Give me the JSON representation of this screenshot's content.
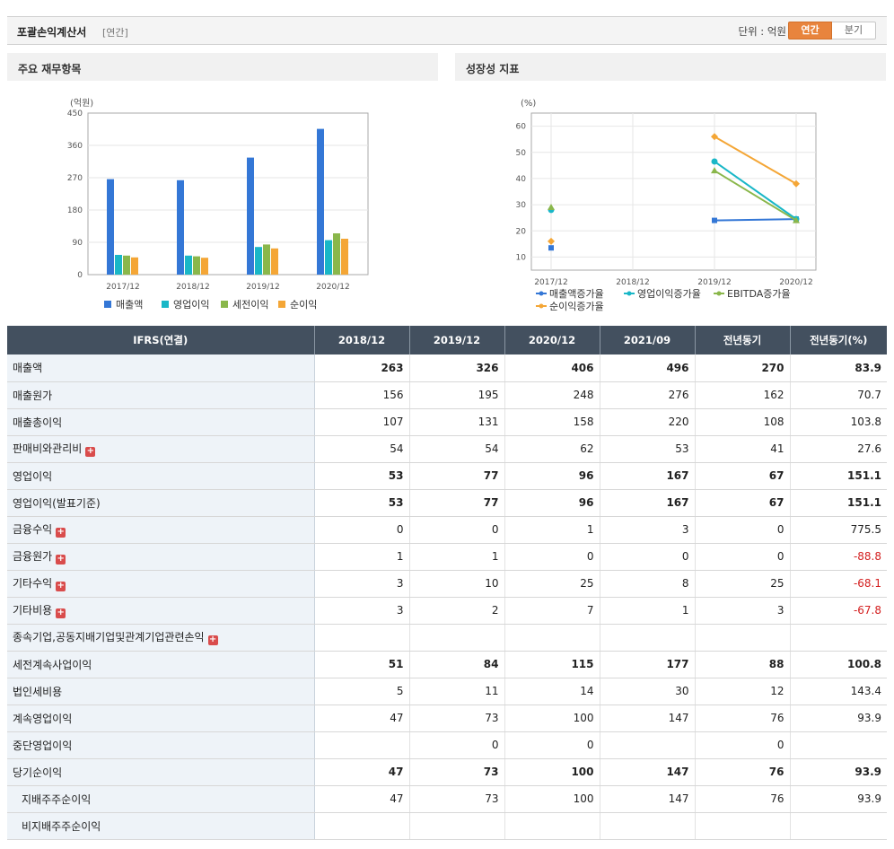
{
  "header": {
    "title": "포괄손익계산서",
    "period": "[연간]",
    "unit": "단위 : 억원",
    "tabs": [
      {
        "label": "연간",
        "active": true
      },
      {
        "label": "분기",
        "active": false
      }
    ]
  },
  "colors": {
    "revenue": "#3477d6",
    "op_income": "#19b7c7",
    "pretax": "#8ab74b",
    "net": "#f4a636",
    "header_bg": "#43505f",
    "negative": "#d42020",
    "tab_active": "#e8843d"
  },
  "chart_data": [
    {
      "type": "bar",
      "title": "주요 재무항목",
      "ylabel": "(억원)",
      "categories": [
        "2017/12",
        "2018/12",
        "2019/12",
        "2020/12"
      ],
      "ylim": [
        0,
        450
      ],
      "yticks": [
        "0",
        "90",
        "180",
        "270",
        "360",
        "450"
      ],
      "series": [
        {
          "name": "매출액",
          "values": [
            266,
            263,
            326,
            406
          ]
        },
        {
          "name": "영업이익",
          "values": [
            55,
            53,
            77,
            96
          ]
        },
        {
          "name": "세전이익",
          "values": [
            53,
            51,
            84,
            115
          ]
        },
        {
          "name": "순이익",
          "values": [
            48,
            47,
            73,
            100
          ]
        }
      ],
      "legend": "bottom",
      "grid": true
    },
    {
      "type": "line",
      "title": "성장성 지표",
      "ylabel": "(%)",
      "categories": [
        "2017/12",
        "2018/12",
        "2019/12",
        "2020/12"
      ],
      "ylim": [
        5,
        65
      ],
      "yticks": [
        "10",
        "20",
        "30",
        "40",
        "50",
        "60"
      ],
      "series": [
        {
          "name": "매출액증가율",
          "values": [
            13.5,
            null,
            24,
            24.5
          ]
        },
        {
          "name": "영업이익증가율",
          "values": [
            28,
            null,
            46.5,
            24.5
          ]
        },
        {
          "name": "EBITDA증가율",
          "values": [
            29,
            null,
            43,
            24
          ]
        },
        {
          "name": "순이익증가율",
          "values": [
            16,
            null,
            56,
            38
          ]
        }
      ],
      "legend": "bottom",
      "grid": true
    }
  ],
  "table": {
    "columns": [
      "IFRS(연결)",
      "2018/12",
      "2019/12",
      "2020/12",
      "2021/09",
      "전년동기",
      "전년동기(%)"
    ],
    "rows": [
      {
        "label": "매출액",
        "bold": true,
        "values": [
          "263",
          "326",
          "406",
          "496",
          "270",
          "83.9"
        ]
      },
      {
        "label": "매출원가",
        "values": [
          "156",
          "195",
          "248",
          "276",
          "162",
          "70.7"
        ]
      },
      {
        "label": "매출총이익",
        "values": [
          "107",
          "131",
          "158",
          "220",
          "108",
          "103.8"
        ]
      },
      {
        "label": "판매비와관리비",
        "expand": true,
        "values": [
          "54",
          "54",
          "62",
          "53",
          "41",
          "27.6"
        ]
      },
      {
        "label": "영업이익",
        "bold": true,
        "values": [
          "53",
          "77",
          "96",
          "167",
          "67",
          "151.1"
        ]
      },
      {
        "label": "영업이익(발표기준)",
        "bold": true,
        "values": [
          "53",
          "77",
          "96",
          "167",
          "67",
          "151.1"
        ]
      },
      {
        "label": "금융수익",
        "expand": true,
        "values": [
          "0",
          "0",
          "1",
          "3",
          "0",
          "775.5"
        ]
      },
      {
        "label": "금융원가",
        "expand": true,
        "values": [
          "1",
          "1",
          "0",
          "0",
          "0",
          "-88.8"
        ]
      },
      {
        "label": "기타수익",
        "expand": true,
        "values": [
          "3",
          "10",
          "25",
          "8",
          "25",
          "-68.1"
        ]
      },
      {
        "label": "기타비용",
        "expand": true,
        "values": [
          "3",
          "2",
          "7",
          "1",
          "3",
          "-67.8"
        ]
      },
      {
        "label": "종속기업,공동지배기업및관계기업관련손익",
        "expand": true,
        "values": [
          "",
          "",
          "",
          "",
          "",
          ""
        ]
      },
      {
        "label": "세전계속사업이익",
        "bold": true,
        "values": [
          "51",
          "84",
          "115",
          "177",
          "88",
          "100.8"
        ]
      },
      {
        "label": "법인세비용",
        "values": [
          "5",
          "11",
          "14",
          "30",
          "12",
          "143.4"
        ]
      },
      {
        "label": "계속영업이익",
        "values": [
          "47",
          "73",
          "100",
          "147",
          "76",
          "93.9"
        ]
      },
      {
        "label": "중단영업이익",
        "values": [
          "",
          "0",
          "0",
          "",
          "0",
          ""
        ]
      },
      {
        "label": "당기순이익",
        "bold": true,
        "values": [
          "47",
          "73",
          "100",
          "147",
          "76",
          "93.9"
        ]
      },
      {
        "label": "지배주주순이익",
        "indent": true,
        "values": [
          "47",
          "73",
          "100",
          "147",
          "76",
          "93.9"
        ]
      },
      {
        "label": "비지배주주순이익",
        "indent": true,
        "values": [
          "",
          "",
          "",
          "",
          "",
          ""
        ]
      }
    ]
  }
}
